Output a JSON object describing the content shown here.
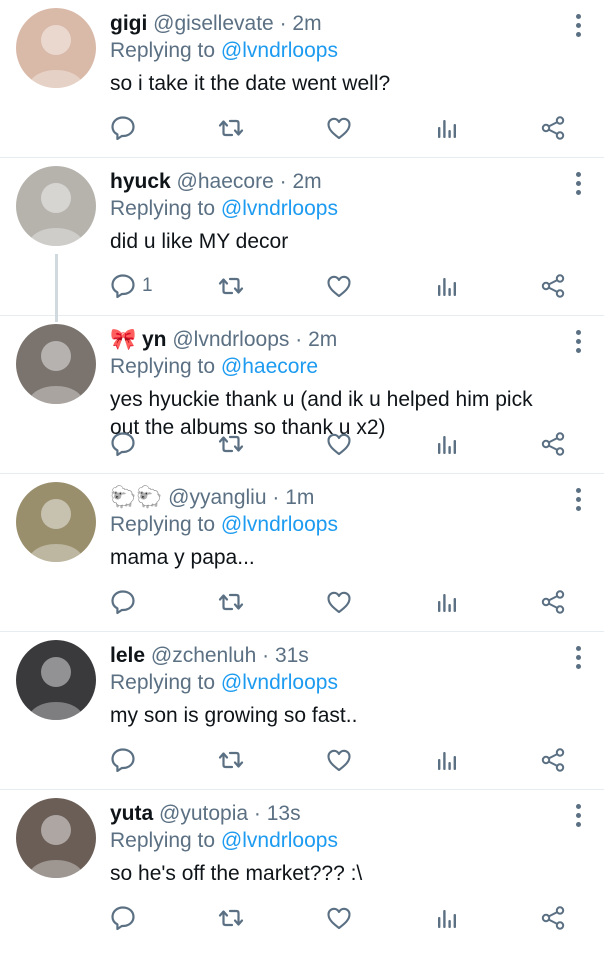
{
  "replying_label": "Replying to",
  "colors": {
    "link": "#1d9bf0",
    "muted": "#5b7083",
    "text": "#0f1419"
  },
  "tweets": [
    {
      "name": "gigi",
      "handle": "@gisellevate",
      "time": "2m",
      "reply_to": "@lvndrloops",
      "text": "so i take it the date went well?",
      "reply_count": "",
      "avatar_bg": "#d9b9a8"
    },
    {
      "name": "hyuck",
      "handle": "@haecore",
      "time": "2m",
      "reply_to": "@lvndrloops",
      "text": "did u like MY decor",
      "reply_count": "1",
      "avatar_bg": "#b6b3ad"
    },
    {
      "name": "🎀 yn",
      "handle": "@lvndrloops",
      "time": "2m",
      "reply_to": "@haecore",
      "text": "yes hyuckie thank u (and ik u helped him pick out the albums so thank u x2)",
      "reply_count": "",
      "avatar_bg": "#7b746e"
    },
    {
      "name": "🐑🐑",
      "handle": "@yyangliu",
      "time": "1m",
      "reply_to": "@lvndrloops",
      "text": "mama y papa...",
      "reply_count": "",
      "avatar_bg": "#9a8f6d"
    },
    {
      "name": "lele",
      "handle": "@zchenluh",
      "time": "31s",
      "reply_to": "@lvndrloops",
      "text": "my son is growing so fast..",
      "reply_count": "",
      "avatar_bg": "#3a3a3d"
    },
    {
      "name": "yuta",
      "handle": "@yutopia",
      "time": "13s",
      "reply_to": "@lvndrloops",
      "text": "so he's off the market??? :\\",
      "reply_count": "",
      "avatar_bg": "#6b5e57"
    }
  ]
}
